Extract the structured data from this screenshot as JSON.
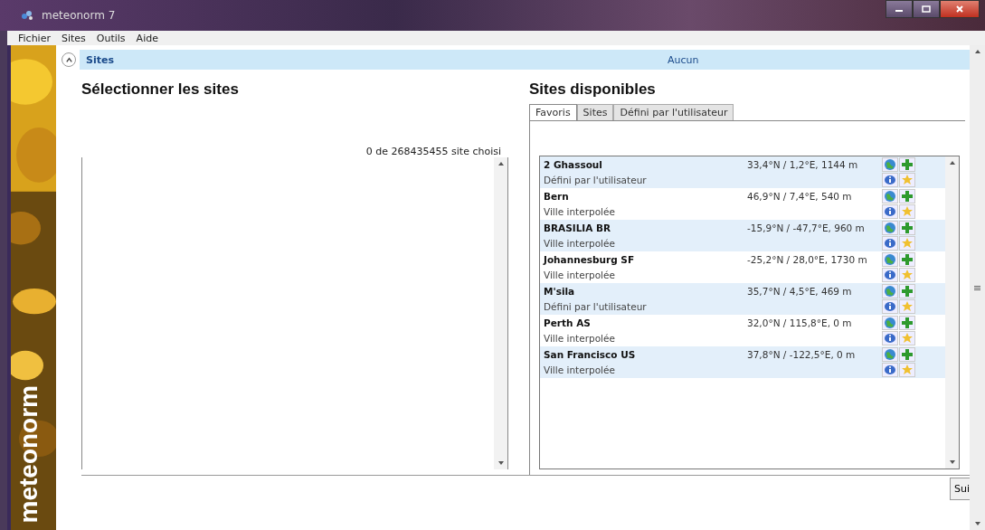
{
  "window": {
    "title": "meteonorm 7"
  },
  "menu": [
    "Fichier",
    "Sites",
    "Outils",
    "Aide"
  ],
  "brand": "meteonorm",
  "section": {
    "title": "Sites",
    "expanded": true,
    "value": "Aucun"
  },
  "selected_sites": {
    "heading": "Sélectionner les sites",
    "count": "0 de 268435455 site choisi"
  },
  "available_sites": {
    "heading": "Sites disponibles",
    "tabs": [
      {
        "label": "Favoris",
        "selected": true
      },
      {
        "label": "Sites",
        "selected": false
      },
      {
        "label": "Défini par l'utilisateur",
        "selected": false
      }
    ],
    "sites": [
      {
        "name": "2 Ghassoul",
        "coords": "33,4°N / 1,2°E, 1144 m",
        "type": "Défini par l'utilisateur"
      },
      {
        "name": "Bern",
        "coords": "46,9°N / 7,4°E, 540 m",
        "type": "Ville interpolée"
      },
      {
        "name": "BRASILIA BR",
        "coords": "-15,9°N / -47,7°E, 960 m",
        "type": "Ville interpolée"
      },
      {
        "name": "Johannesburg SF",
        "coords": "-25,2°N / 28,0°E, 1730 m",
        "type": "Ville interpolée"
      },
      {
        "name": "M'sila",
        "coords": "35,7°N / 4,5°E, 469 m",
        "type": "Défini par l'utilisateur"
      },
      {
        "name": "Perth AS",
        "coords": "32,0°N / 115,8°E, 0 m",
        "type": "Ville interpolée"
      },
      {
        "name": "San Francisco US",
        "coords": "37,8°N / -122,5°E, 0 m",
        "type": "Ville interpolée"
      }
    ]
  },
  "next_button": "Sui"
}
